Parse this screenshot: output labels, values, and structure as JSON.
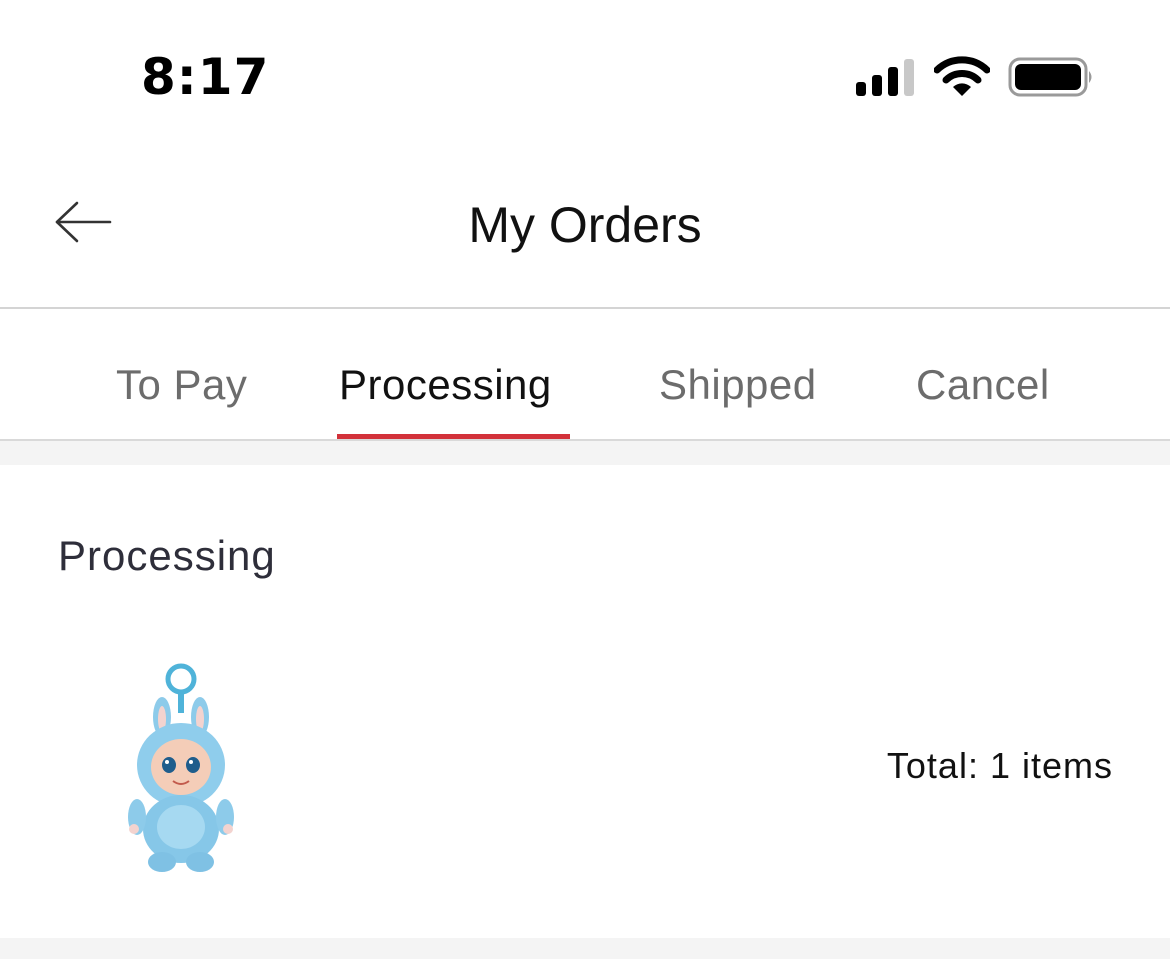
{
  "status_bar": {
    "time": "8:17",
    "icons": [
      "signal-icon",
      "wifi-icon",
      "battery-icon"
    ]
  },
  "header": {
    "title": "My Orders",
    "back_icon": "arrow-left-icon"
  },
  "tabs": [
    {
      "label": "To Pay",
      "active": false
    },
    {
      "label": "Processing",
      "active": true
    },
    {
      "label": "Shipped",
      "active": false
    },
    {
      "label": "Cancel",
      "active": false
    }
  ],
  "colors": {
    "accent": "#d2313a",
    "tab_inactive": "#6c6c6c",
    "tab_active": "#111111",
    "separator": "#f4f4f4"
  },
  "orders": [
    {
      "status": "Processing",
      "product_image": "blue-plush-keychain-figure",
      "total_text": "Total: 1 items"
    }
  ]
}
